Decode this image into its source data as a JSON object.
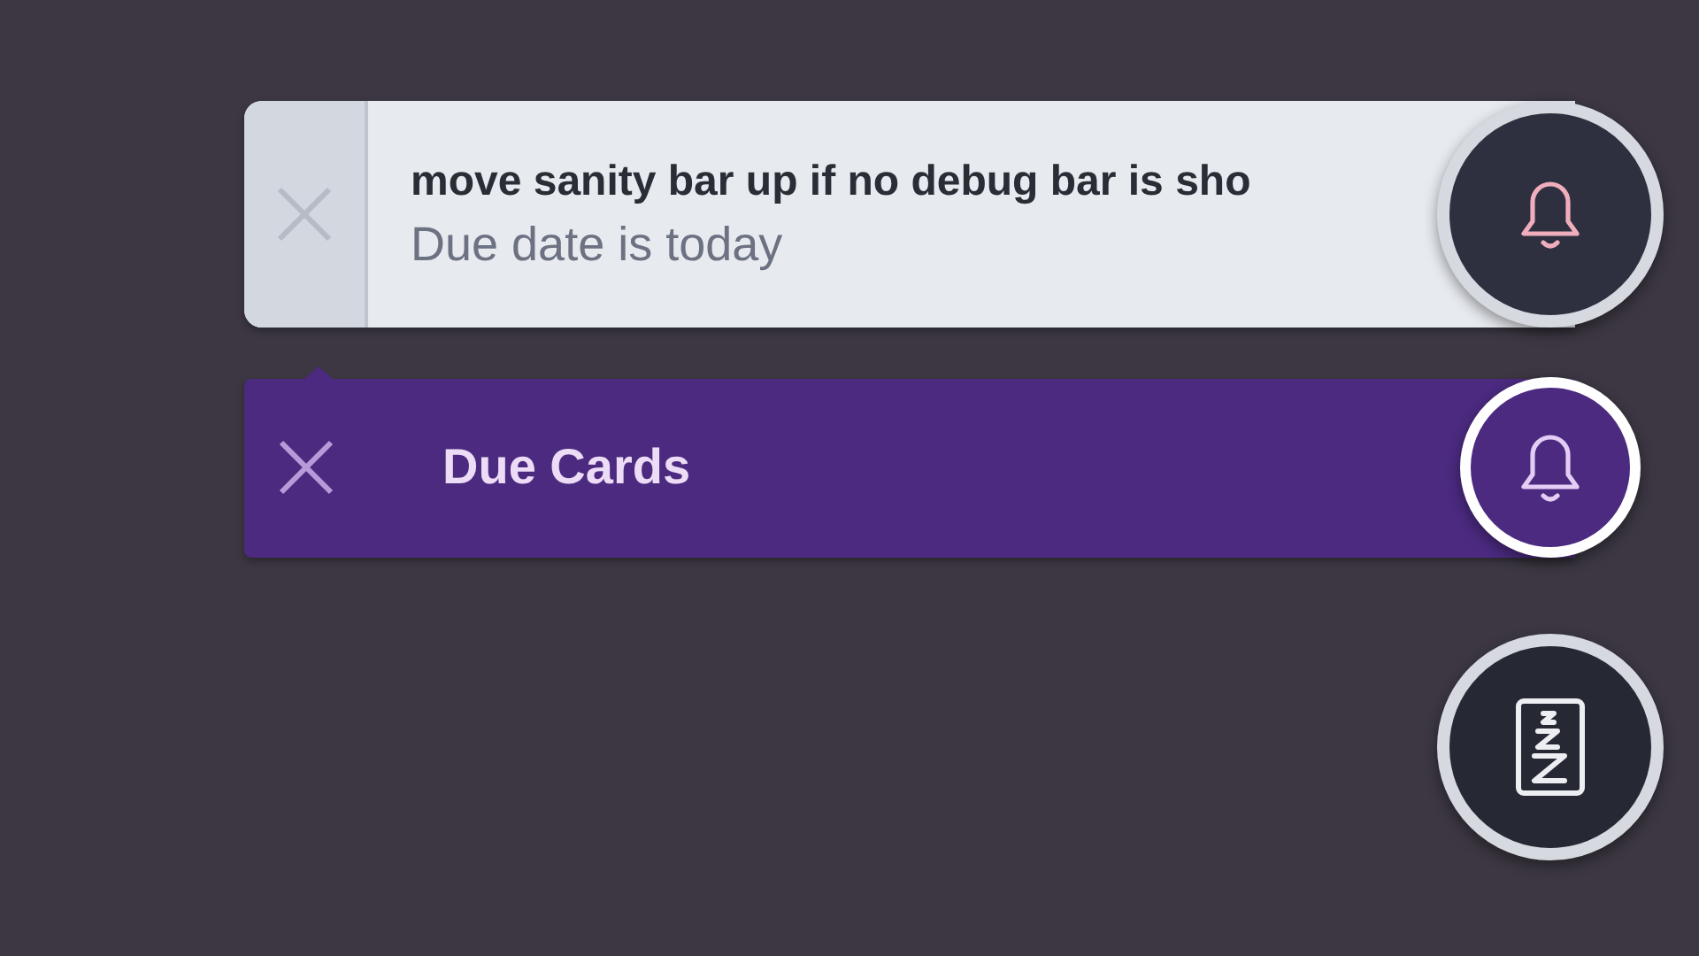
{
  "notifications": [
    {
      "kind": "reminder",
      "title": "move sanity bar up if no debug bar is sho",
      "subtitle": "Due date is today"
    },
    {
      "kind": "banner",
      "title": "Due Cards"
    },
    {
      "kind": "snooze"
    }
  ]
}
